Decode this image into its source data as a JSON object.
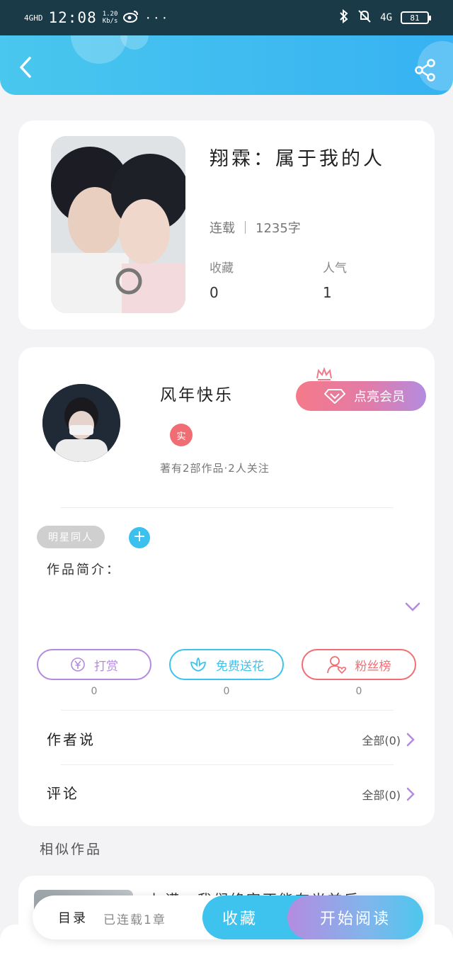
{
  "status_bar": {
    "network": "4GHD",
    "time": "12:08",
    "speed_value": "1.20",
    "speed_unit": "Kb/s",
    "network_right": "4G",
    "battery": "81"
  },
  "book": {
    "title": "翔霖：属于我的人",
    "status": "连载",
    "word_count": "1235字",
    "favorites_label": "收藏",
    "favorites_value": "0",
    "popularity_label": "人气",
    "popularity_value": "1"
  },
  "author": {
    "name": "风年快乐",
    "badge": "实",
    "summary": "著有2部作品·2人关注",
    "vip_label": "点亮会员"
  },
  "tags": {
    "items": [
      "明星同人"
    ],
    "add_label": "+"
  },
  "intro": {
    "label": "作品简介："
  },
  "actions": [
    {
      "label": "打赏",
      "count": "0",
      "icon": "yuan-icon",
      "color": "#b48ae0"
    },
    {
      "label": "免费送花",
      "count": "0",
      "icon": "flower-icon",
      "color": "#3ec3ee"
    },
    {
      "label": "粉丝榜",
      "count": "0",
      "icon": "fans-icon",
      "color": "#f06e73"
    }
  ],
  "rows": {
    "author_says": {
      "label": "作者说",
      "right": "全部(0)"
    },
    "comments": {
      "label": "评论",
      "right": "全部(0)"
    }
  },
  "similar": {
    "title": "相似作品",
    "first_item_text": "七诺：我们终究不能在光前后"
  },
  "bottom": {
    "toc_label": "目录",
    "toc_sub": "已连载1章",
    "favorite_button": "收藏",
    "read_button": "开始阅读"
  },
  "colors": {
    "header_start": "#49c7ee",
    "header_end": "#37b2f2",
    "accent_purple": "#b48ae0",
    "accent_blue": "#3ec3ee",
    "accent_red": "#f06e73"
  }
}
